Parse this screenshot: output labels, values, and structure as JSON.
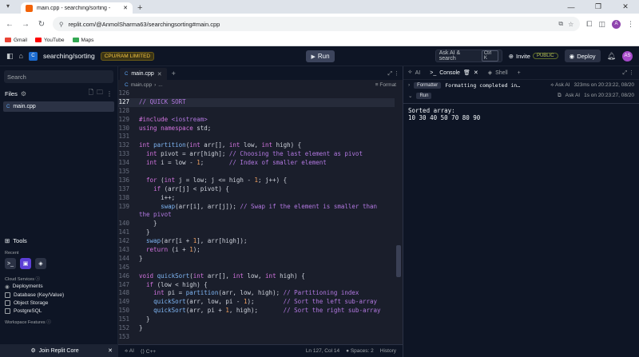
{
  "browser": {
    "tab_title": "main.cpp - searching/sorting - ",
    "url": "replit.com/@AnmolSharma63/searchingsorting#main.cpp",
    "bookmarks": [
      "Gmail",
      "YouTube",
      "Maps"
    ]
  },
  "header": {
    "repl_name": "searching/sorting",
    "badge": "CPU/RAM LIMITED",
    "run_label": "Run",
    "ask_ai": "Ask AI & search",
    "shortcut": "Ctrl K",
    "invite": "Invite",
    "public": "PUBLIC",
    "deploy": "Deploy",
    "avatar": "AS"
  },
  "sidebar": {
    "search_placeholder": "Search",
    "files_label": "Files",
    "file": "main.cpp",
    "tools_label": "Tools",
    "recent_label": "Recent",
    "cloud_label": "Cloud Services",
    "services": [
      "Deployments",
      "Database (Key/Value)",
      "Object Storage",
      "PostgreSQL"
    ],
    "workspace_label": "Workspace Features",
    "join_label": "Join Replit Core"
  },
  "editor": {
    "tab": "main.cpp",
    "breadcrumb": "main.cpp",
    "breadcrumb_more": "...",
    "format": "Format",
    "status_ai": "AI",
    "status_lang": "C++",
    "status_pos": "Ln 127, Col 14",
    "status_spaces": "Spaces: 2",
    "status_history": "History"
  },
  "console": {
    "tabs": [
      "AI",
      "Console",
      "Shell"
    ],
    "row1_pill": "Formatter",
    "row1_msg": "Formatting completed in…",
    "row1_ask": "Ask AI",
    "row1_meta": "323ms on 20:23:22, 08/20",
    "row2_pill": "Run",
    "row2_ask": "Ask AI",
    "row2_meta": "1s on 20:23:27, 08/20",
    "output_1": "Sorted array:",
    "output_2": "10 30 40 50 70 80 90"
  }
}
